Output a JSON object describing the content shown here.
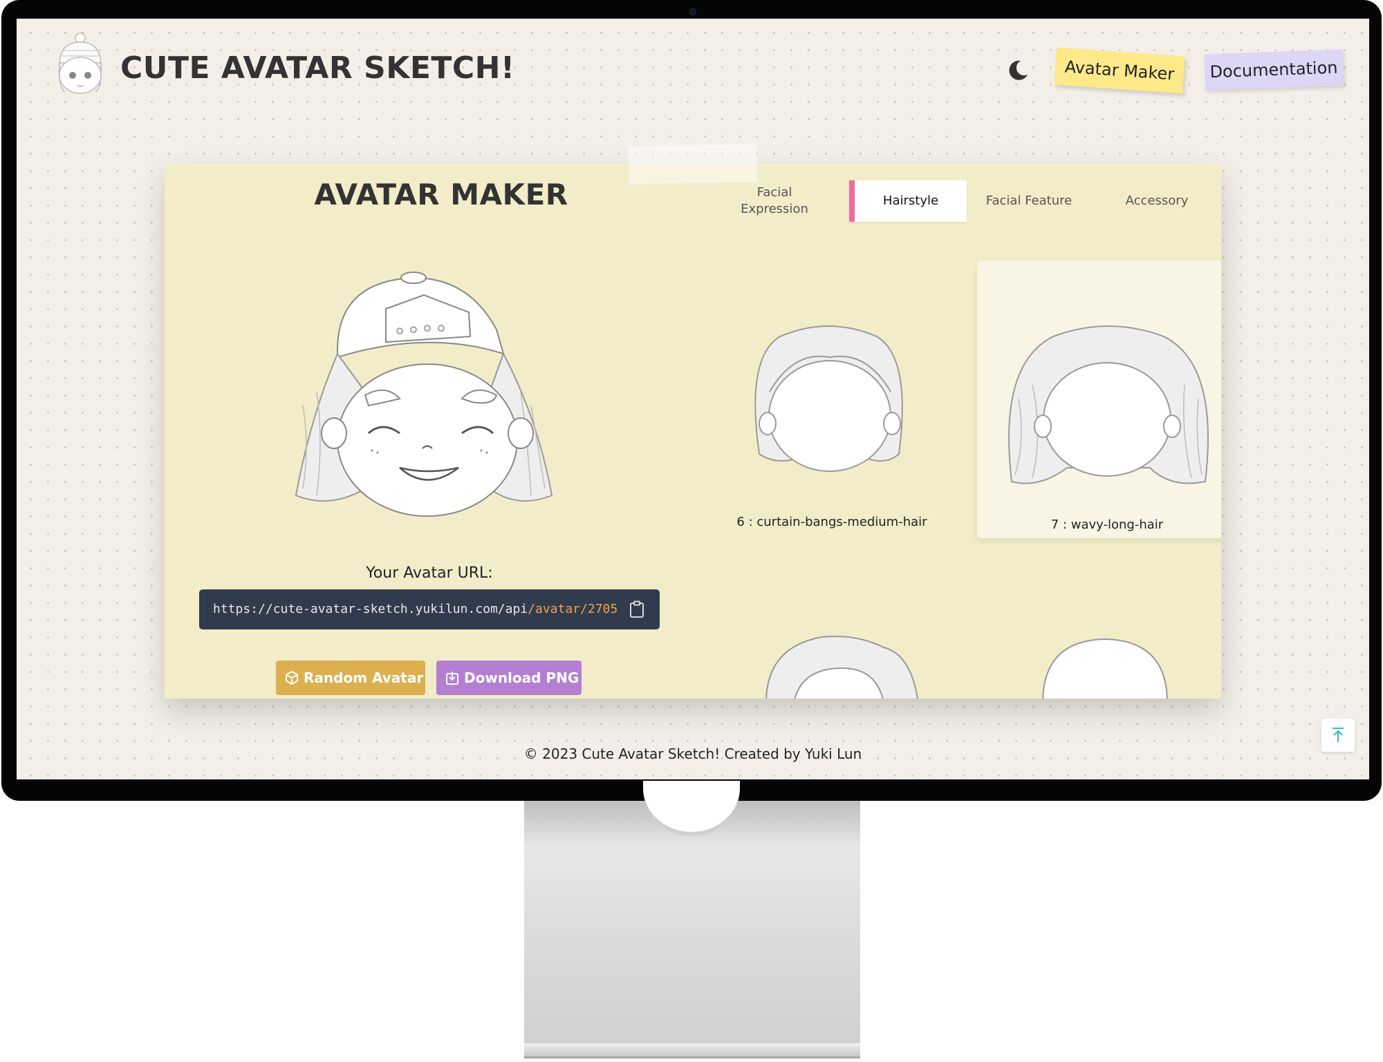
{
  "header": {
    "site_title": "CUTE AVATAR SKETCH!",
    "nav": {
      "avatar_maker": "Avatar Maker",
      "documentation": "Documentation"
    },
    "theme_toggle_icon": "moon-icon"
  },
  "maker": {
    "title": "AVATAR MAKER",
    "url_label": "Your Avatar URL:",
    "url_base": "https://cute-avatar-sketch.yukilun.com/api",
    "url_path": "/avatar/2705",
    "buttons": {
      "random": "Random Avatar",
      "download": "Download PNG"
    },
    "tabs": [
      {
        "label": "Facial Expression",
        "active": false
      },
      {
        "label": "Hairstyle",
        "active": true
      },
      {
        "label": "Facial Feature",
        "active": false
      },
      {
        "label": "Accessory",
        "active": false
      }
    ],
    "hairstyles": [
      {
        "label": "6 : curtain-bangs-medium-hair",
        "selected": false
      },
      {
        "label": "7 : wavy-long-hair",
        "selected": true
      }
    ]
  },
  "footer": {
    "copyright": "© 2023 Cute Avatar Sketch! Created by Yuki Lun"
  },
  "colors": {
    "page_bg": "#f3efe8",
    "card_bg": "#f2ecc9",
    "nav_avatar_bg": "#fde98a",
    "nav_doc_bg": "#dcd6f7",
    "active_tab_accent": "#ee6ba0",
    "url_box_bg": "#303c4e",
    "url_accent": "#f4a24a",
    "random_btn": "#dcb04e",
    "download_btn": "#b47fd3"
  }
}
